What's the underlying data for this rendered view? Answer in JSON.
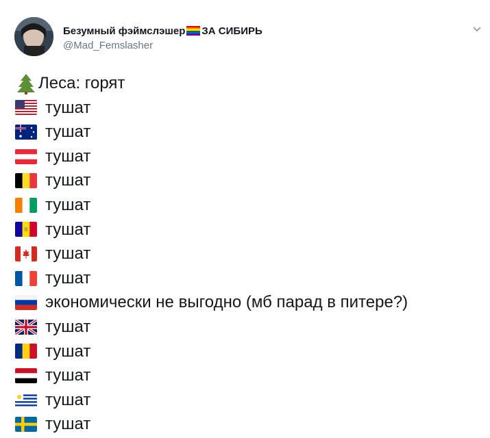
{
  "author": {
    "name": "Безумный фэймслэшер",
    "badge_text": "ЗА СИБИРЬ",
    "handle": "@Mad_Femslasher"
  },
  "icons": {
    "avatar": "avatar",
    "pride": "rainbow-flag-icon",
    "menu": "chevron-down-icon",
    "tree": "evergreen-tree-icon"
  },
  "colors": {
    "text": "#14171a",
    "secondary": "#657786"
  },
  "tweet": {
    "first_line": "Леса: горят",
    "lines": [
      {
        "flag": "us-flag-icon",
        "text": "тушат"
      },
      {
        "flag": "australia-flag-icon",
        "text": "тушат"
      },
      {
        "flag": "austria-flag-icon",
        "text": "тушат"
      },
      {
        "flag": "belgium-flag-icon",
        "text": "тушат"
      },
      {
        "flag": "ivory-coast-flag-icon",
        "text": "тушат"
      },
      {
        "flag": "andorra-flag-icon",
        "text": "тушат"
      },
      {
        "flag": "canada-flag-icon",
        "text": "тушат"
      },
      {
        "flag": "france-flag-icon",
        "text": "тушат"
      },
      {
        "flag": "russia-flag-icon",
        "text": "экономически не выгодно (мб парад в питере?)"
      },
      {
        "flag": "uk-flag-icon",
        "text": "тушат"
      },
      {
        "flag": "romania-flag-icon",
        "text": "тушат"
      },
      {
        "flag": "yemen-flag-icon",
        "text": "тушат"
      },
      {
        "flag": "uruguay-flag-icon",
        "text": "тушат"
      },
      {
        "flag": "sweden-flag-icon",
        "text": "тушат"
      }
    ]
  }
}
